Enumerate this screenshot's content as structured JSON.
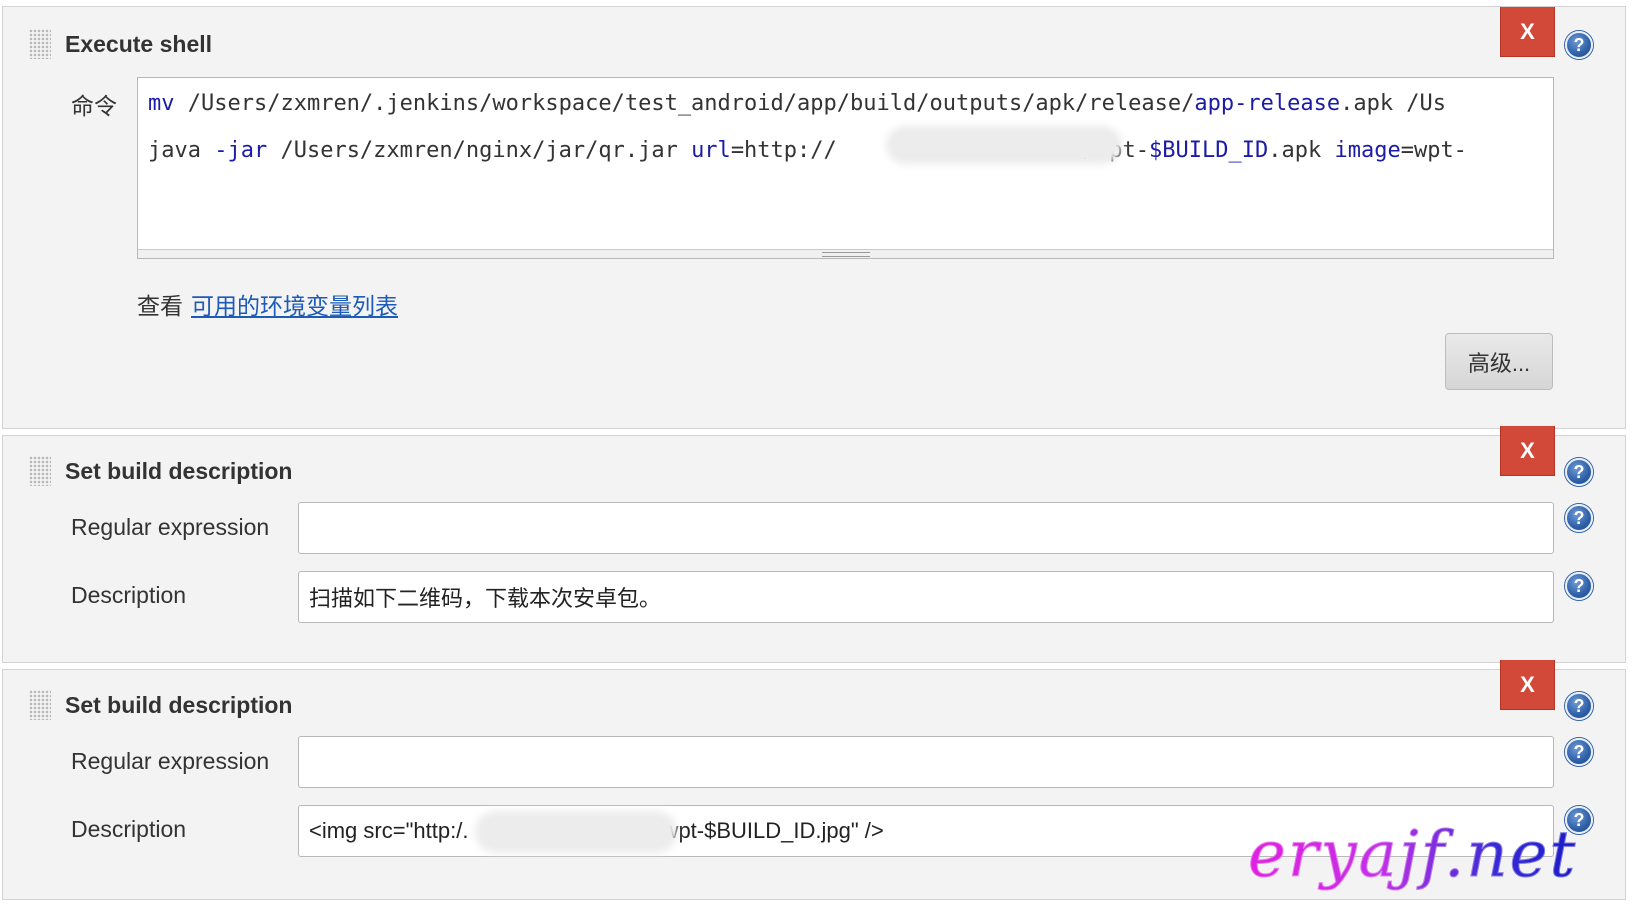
{
  "shell": {
    "title": "Execute shell",
    "command_label": "命令",
    "line1": {
      "kw": "mv",
      "rest": " /Users/zxmren/.jenkins/workspace/test_android/app/build/outputs/apk/release/",
      "kw2": "app-release",
      "tail": ".apk /Us"
    },
    "line2": {
      "start": "java ",
      "kw": "-jar",
      "mid": " /Users/zxmren/nginx/jar/qr.jar ",
      "kw2": "url",
      "mid2": "=http://",
      "after_blur": "/wpt-",
      "kw3": "$BUILD_ID",
      "mid3": ".apk ",
      "kw4": "image",
      "tail": "=wpt-"
    },
    "env_prefix": "查看",
    "env_link": "可用的环境变量列表",
    "advanced_button": "高级...",
    "delete_label": "X"
  },
  "desc1": {
    "title": "Set build description",
    "regex_label": "Regular expression",
    "regex_value": "",
    "description_label": "Description",
    "description_value": "扫描如下二维码，下载本次安卓包。",
    "delete_label": "X"
  },
  "desc2": {
    "title": "Set build description",
    "regex_label": "Regular expression",
    "regex_value": "",
    "description_label": "Description",
    "description_prefix": "<img src=\"http:/.",
    "description_suffix": "/wpt-$BUILD_ID.jpg\" />",
    "delete_label": "X"
  },
  "help_glyph": "?",
  "watermark": "eryajf.net",
  "colors": {
    "delete_red": "#d24939",
    "help_blue": "#2e5fa6",
    "link_blue": "#1d5bb8",
    "keyword_blue": "#1b1ba8",
    "section_bg": "#f3f3f3"
  }
}
